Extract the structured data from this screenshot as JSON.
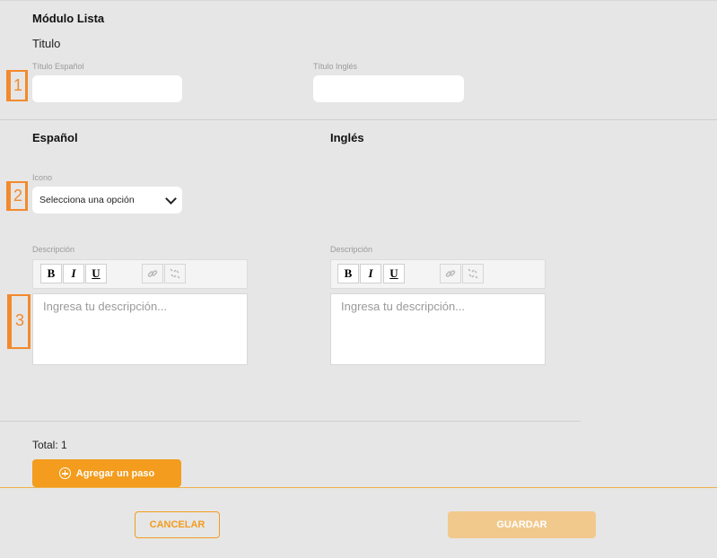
{
  "module": {
    "title": "Módulo Lista"
  },
  "titulo_section": {
    "heading": "Titulo",
    "spanish_label": "Título Español",
    "spanish_value": "",
    "english_label": "Título Inglés",
    "english_value": ""
  },
  "markers": [
    "1",
    "2",
    "3"
  ],
  "columns": {
    "spanish": {
      "heading": "Español",
      "icon_label": "Icono",
      "icon_selected": "Selecciona una opción",
      "description_label": "Descripción",
      "description_placeholder": "Ingresa tu descripción..."
    },
    "english": {
      "heading": "Inglés",
      "description_label": "Descripción",
      "description_placeholder": "Ingresa tu descripción..."
    }
  },
  "toolbar": {
    "bold": "B",
    "italic": "I",
    "underline": "U"
  },
  "footer": {
    "total": "Total: 1",
    "add_step": "Agregar un paso",
    "cancel": "CANCELAR",
    "save": "GUARDAR"
  },
  "colors": {
    "accent": "#f39c1e",
    "accent_disabled": "#f1c98d",
    "marker": "#f28a2e",
    "background": "#e6e6e6"
  }
}
